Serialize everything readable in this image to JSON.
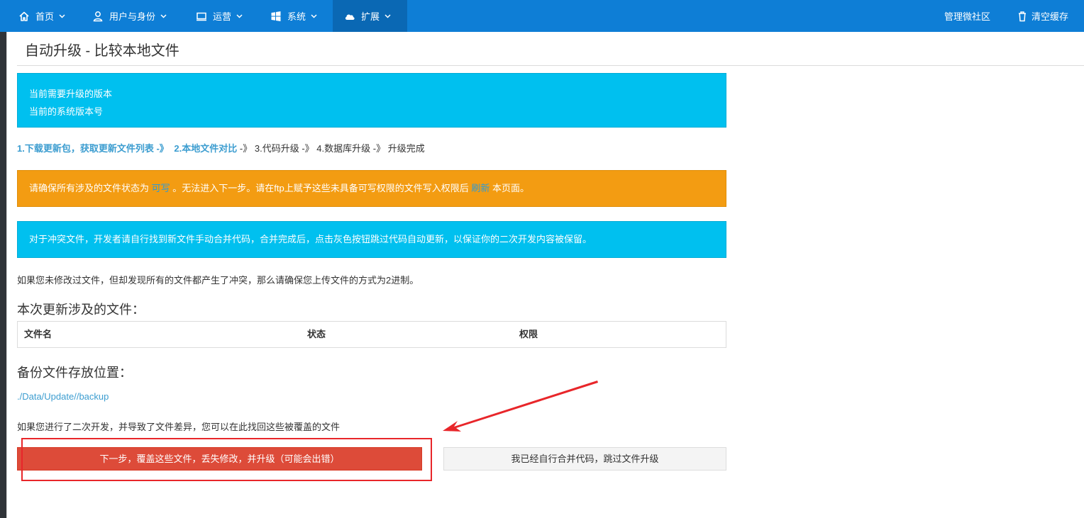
{
  "nav": {
    "items": [
      {
        "label": "首页",
        "icon": "home-icon"
      },
      {
        "label": "用户与身份",
        "icon": "user-icon"
      },
      {
        "label": "运营",
        "icon": "monitor-icon"
      },
      {
        "label": "系统",
        "icon": "windows-icon"
      },
      {
        "label": "扩展",
        "icon": "cloud-icon"
      }
    ],
    "right": {
      "community": "管理微社区",
      "clear_cache": "清空缓存"
    }
  },
  "page": {
    "title": "自动升级 - 比较本地文件"
  },
  "version_box": {
    "line1": "当前需要升级的版本",
    "line2": "当前的系统版本号"
  },
  "steps": {
    "step1": "1.下载更新包，获取更新文件列表 -》",
    "step2": "2.本地文件对比",
    "step2_sep": "-》",
    "step3": "3.代码升级 -》",
    "step4": "4.数据库升级 -》",
    "step5": "升级完成"
  },
  "warning": {
    "part1": "请确保所有涉及的文件状态为",
    "writable": "可写",
    "part2": "。无法进入下一步。请在ftp上赋予这些未具备可写权限的文件写入权限后",
    "refresh": "刷新",
    "part3": "本页面。"
  },
  "info": {
    "text": "对于冲突文件，开发者请自行找到新文件手动合并代码，合并完成后，点击灰色按钮跳过代码自动更新，以保证你的二次开发内容被保留。"
  },
  "notes": {
    "binary": "如果您未修改过文件，但却发现所有的文件都产生了冲突，那么请确保您上传文件的方式为2进制。",
    "restore": "如果您进行了二次开发，并导致了文件差异，您可以在此找回这些被覆盖的文件"
  },
  "files": {
    "heading": "本次更新涉及的文件：",
    "columns": [
      "文件名",
      "状态",
      "权限"
    ]
  },
  "backup": {
    "heading": "备份文件存放位置：",
    "path": "./Data/Update//backup"
  },
  "buttons": {
    "next": "下一步，覆盖这些文件，丢失修改，并升级（可能会出错）",
    "skip": "我已经自行合并代码，跳过文件升级"
  },
  "colors": {
    "nav": "#0e7ed6",
    "nav_active": "#0a68b4",
    "info": "#00c0ef",
    "warning": "#f39c12",
    "danger": "#dd4b39",
    "link": "#3c9dd0",
    "annotation": "#e8262a"
  }
}
